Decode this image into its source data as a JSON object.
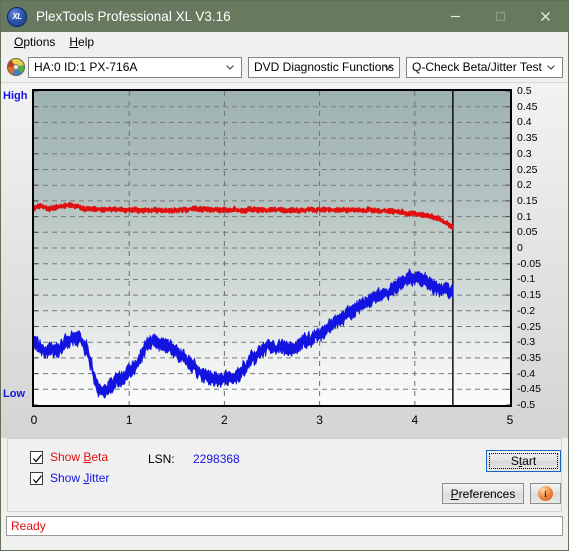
{
  "window": {
    "title": "PlexTools Professional XL V3.16",
    "icon": "xl-disc-icon",
    "minimize_label": "Minimize",
    "maximize_label": "Maximize",
    "close_label": "Close",
    "titlebar_color": "#67795f"
  },
  "menu": {
    "items": [
      {
        "label": "Options",
        "accel": "O"
      },
      {
        "label": "Help",
        "accel": "H"
      }
    ]
  },
  "toolbar": {
    "drive_icon": "cd-disc-icon",
    "drive_select": "HA:0 ID:1  PX-716A",
    "function_select": "DVD Diagnostic Functions",
    "test_select": "Q-Check Beta/Jitter Test"
  },
  "chart_labels": {
    "high": "High",
    "low": "Low"
  },
  "controls": {
    "show_beta_label_pre": "Show ",
    "show_beta_label_accel": "B",
    "show_beta_label_post": "eta",
    "show_beta_checked": true,
    "show_jitter_label_pre": "Show ",
    "show_jitter_label_accel": "J",
    "show_jitter_label_post": "itter",
    "show_jitter_checked": true,
    "lsn_label": "LSN:",
    "lsn_value": "2298368",
    "start_label_pre": "S",
    "start_label_accel": "t",
    "start_label_post": "art",
    "start_button": "Start",
    "preferences_button": "Preferences",
    "preferences_accel": "P",
    "info_button": "i",
    "beta_color": "#e01010",
    "jitter_color": "#1414e0"
  },
  "status": {
    "text": "Ready"
  },
  "chart_data": {
    "type": "line",
    "title": "Q-Check Beta/Jitter Test",
    "xlabel": "",
    "ylabel": "",
    "xlim": [
      0,
      5
    ],
    "ylim": [
      -0.5,
      0.5
    ],
    "xticks": [
      0,
      1,
      2,
      3,
      4,
      5
    ],
    "yticks": [
      0.5,
      0.45,
      0.4,
      0.35,
      0.3,
      0.25,
      0.2,
      0.15,
      0.1,
      0.05,
      0,
      -0.05,
      -0.1,
      -0.15,
      -0.2,
      -0.25,
      -0.3,
      -0.35,
      -0.4,
      -0.45,
      -0.5
    ],
    "ytick_labels": [
      "0.5",
      "0.45",
      "0.4",
      "0.35",
      "0.3",
      "0.25",
      "0.2",
      "0.15",
      "0.1",
      "0.05",
      "0",
      "-0.05",
      "-0.1",
      "-0.15",
      "-0.2",
      "-0.25",
      "-0.3",
      "-0.35",
      "-0.4",
      "-0.45",
      "-0.5"
    ],
    "grid": true,
    "grid_style": "dashed",
    "legend": "external-checkboxes",
    "data_end_marker_x": 4.4,
    "axis_left_label": "High",
    "axis_left_label_bottom": "Low",
    "series": [
      {
        "name": "Beta",
        "color": "#e01010",
        "noise": 0.006,
        "x": [
          0.0,
          0.08,
          0.17,
          0.25,
          0.35,
          0.45,
          0.55,
          0.7,
          0.85,
          1.0,
          1.2,
          1.4,
          1.6,
          1.75,
          1.9,
          2.05,
          2.2,
          2.4,
          2.6,
          2.75,
          2.9,
          3.05,
          3.2,
          3.35,
          3.5,
          3.65,
          3.8,
          3.95,
          4.05,
          4.15,
          4.25,
          4.32,
          4.38,
          4.4
        ],
        "y": [
          0.13,
          0.134,
          0.127,
          0.131,
          0.136,
          0.132,
          0.125,
          0.122,
          0.121,
          0.121,
          0.12,
          0.119,
          0.122,
          0.124,
          0.122,
          0.121,
          0.121,
          0.122,
          0.121,
          0.12,
          0.123,
          0.122,
          0.12,
          0.121,
          0.12,
          0.118,
          0.115,
          0.111,
          0.106,
          0.1,
          0.092,
          0.082,
          0.069,
          0.062
        ]
      },
      {
        "name": "Jitter",
        "color": "#1414e0",
        "noise": 0.016,
        "x": [
          0.0,
          0.05,
          0.1,
          0.16,
          0.22,
          0.28,
          0.34,
          0.4,
          0.46,
          0.5,
          0.55,
          0.6,
          0.64,
          0.68,
          0.74,
          0.82,
          0.9,
          1.0,
          1.06,
          1.12,
          1.18,
          1.26,
          1.34,
          1.42,
          1.5,
          1.58,
          1.66,
          1.74,
          1.82,
          1.9,
          1.98,
          2.06,
          2.14,
          2.22,
          2.3,
          2.38,
          2.46,
          2.54,
          2.62,
          2.7,
          2.8,
          2.9,
          3.0,
          3.1,
          3.2,
          3.3,
          3.4,
          3.5,
          3.6,
          3.7,
          3.8,
          3.88,
          3.94,
          4.0,
          4.06,
          4.12,
          4.2,
          4.28,
          4.34,
          4.4
        ],
        "y": [
          -0.295,
          -0.318,
          -0.33,
          -0.322,
          -0.325,
          -0.318,
          -0.305,
          -0.292,
          -0.288,
          -0.292,
          -0.316,
          -0.368,
          -0.42,
          -0.448,
          -0.455,
          -0.44,
          -0.42,
          -0.4,
          -0.378,
          -0.345,
          -0.312,
          -0.296,
          -0.305,
          -0.318,
          -0.334,
          -0.352,
          -0.372,
          -0.392,
          -0.408,
          -0.418,
          -0.42,
          -0.416,
          -0.402,
          -0.378,
          -0.352,
          -0.33,
          -0.314,
          -0.316,
          -0.322,
          -0.318,
          -0.3,
          -0.29,
          -0.278,
          -0.255,
          -0.23,
          -0.208,
          -0.188,
          -0.172,
          -0.16,
          -0.146,
          -0.122,
          -0.105,
          -0.096,
          -0.092,
          -0.098,
          -0.108,
          -0.122,
          -0.134,
          -0.14,
          -0.142
        ]
      }
    ]
  }
}
